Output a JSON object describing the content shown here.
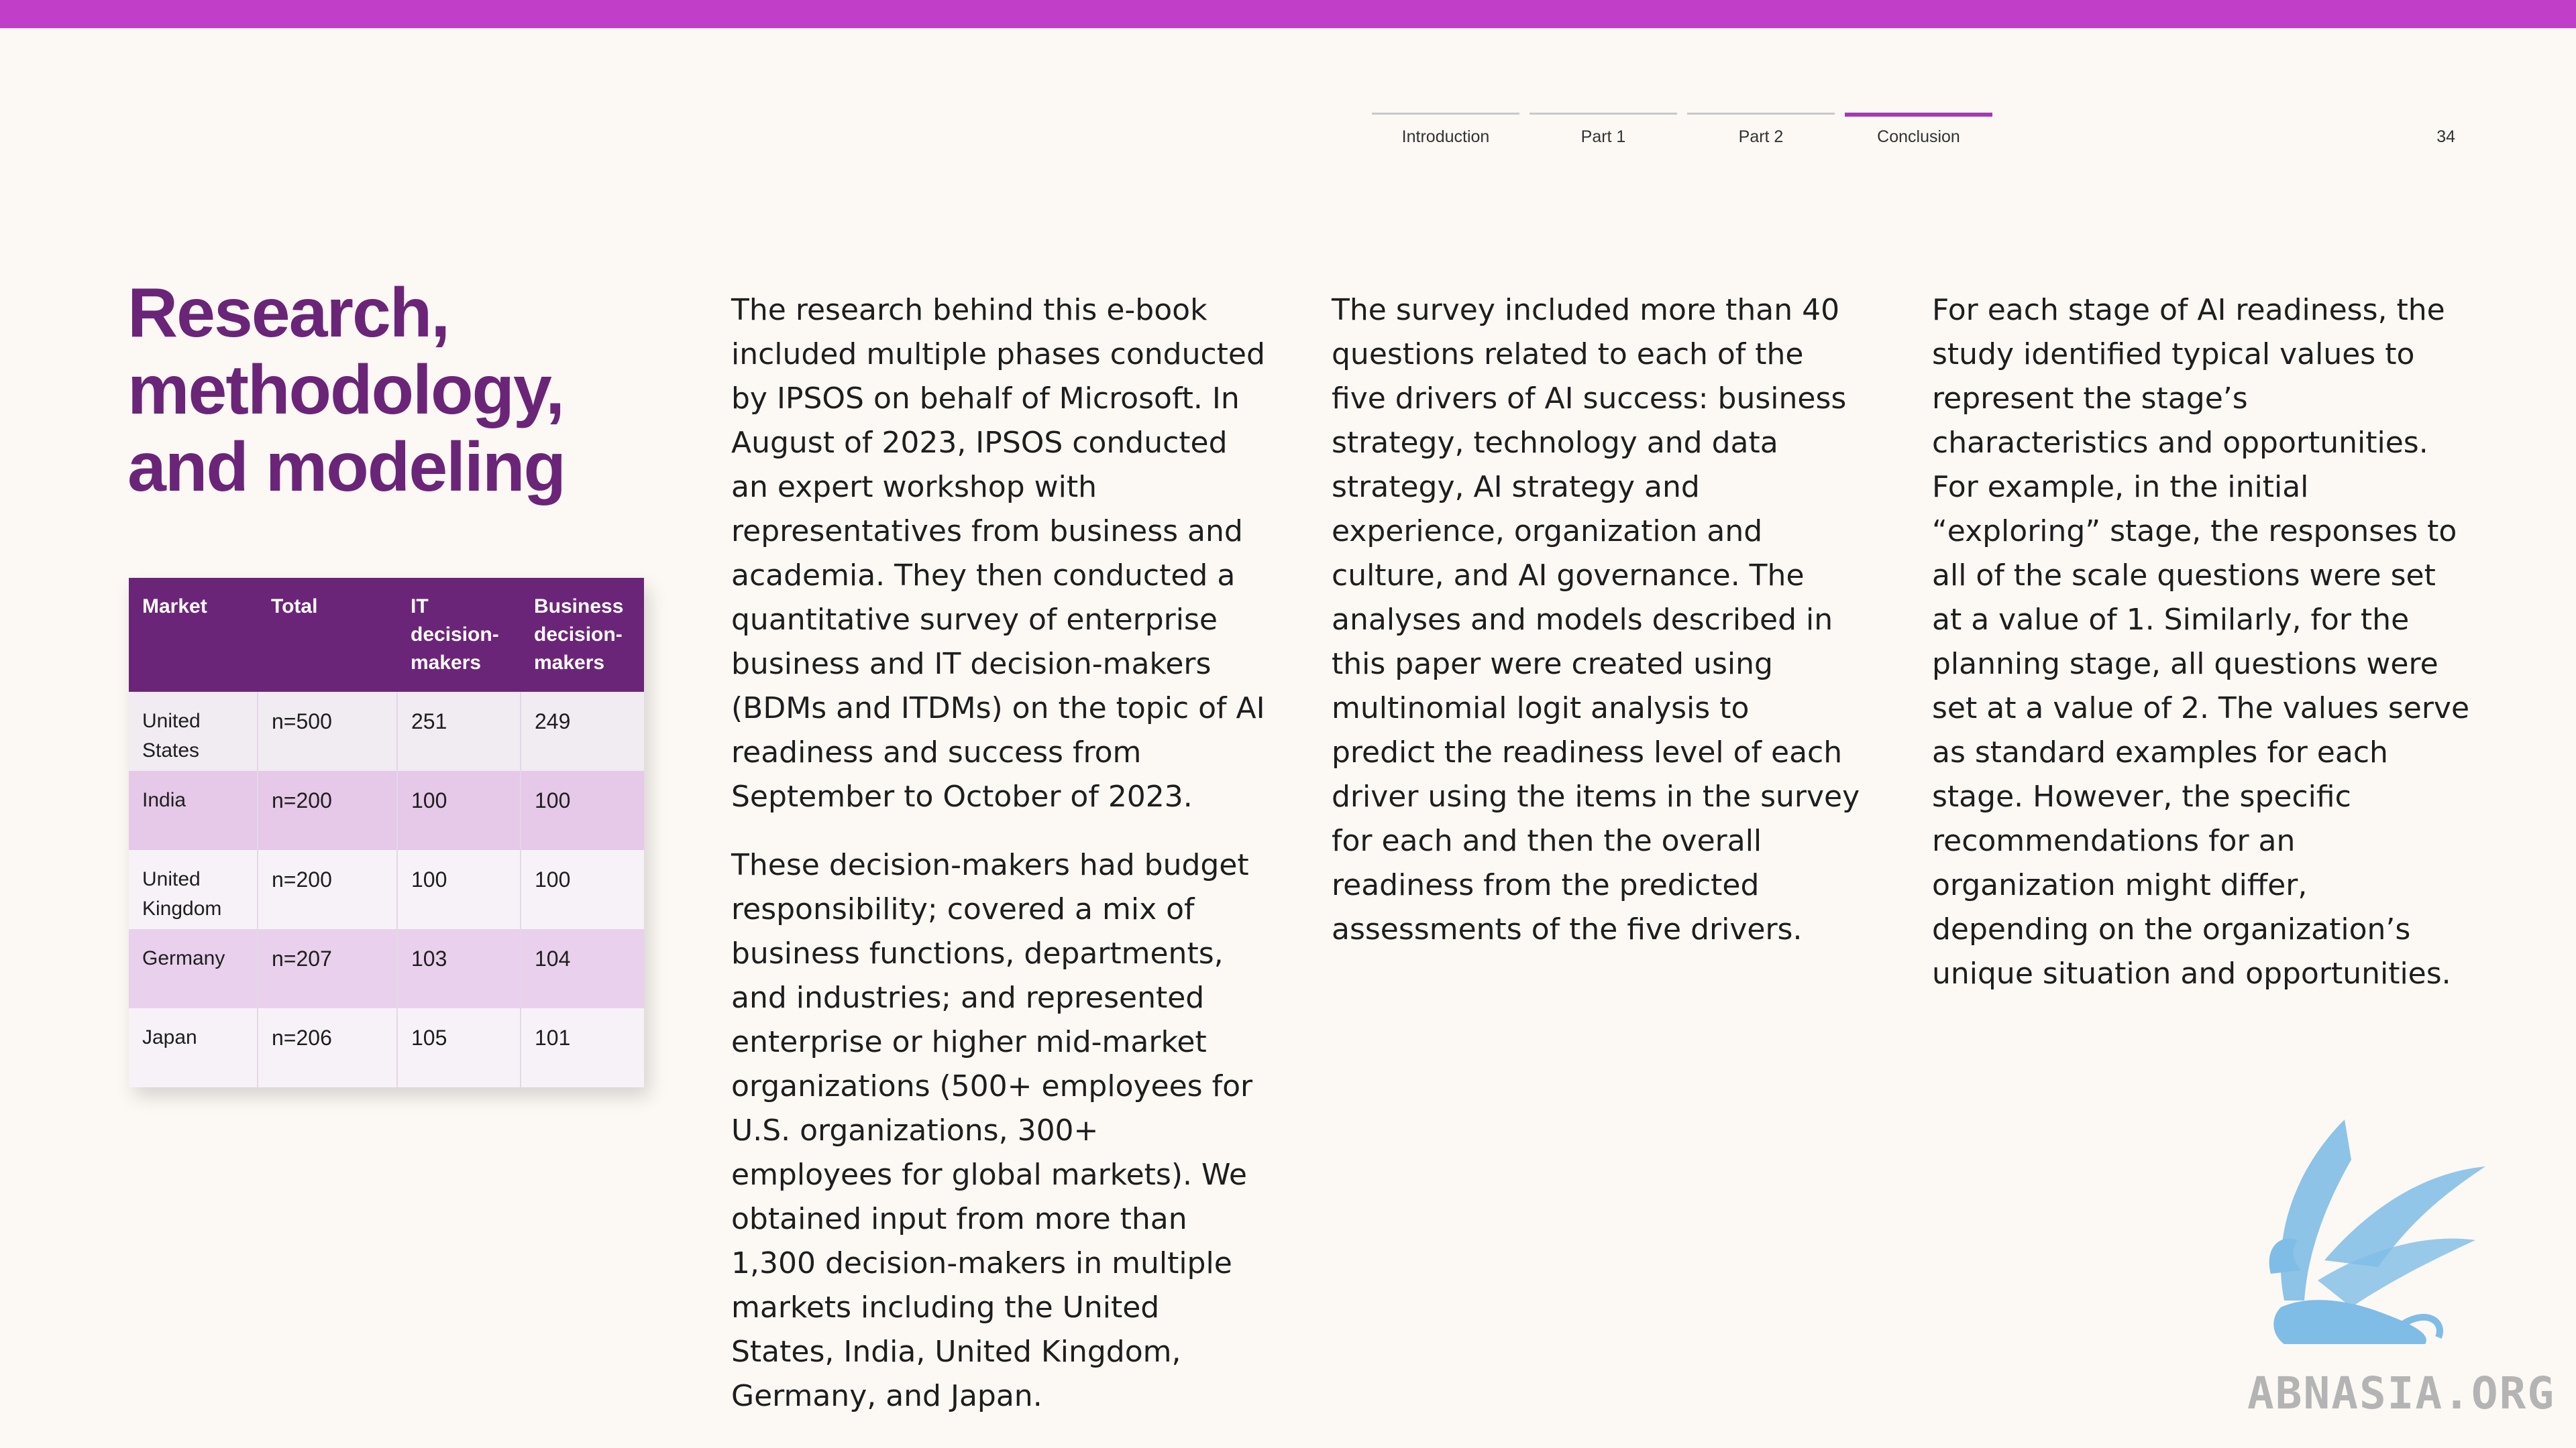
{
  "nav": {
    "items": [
      {
        "label": "Introduction",
        "active": false
      },
      {
        "label": "Part 1",
        "active": false
      },
      {
        "label": "Part 2",
        "active": false
      },
      {
        "label": "Conclusion",
        "active": true
      }
    ],
    "page_number": "34"
  },
  "title": {
    "line1": "Research,",
    "line2": "methodology,",
    "line3": "and modeling"
  },
  "table": {
    "headers": {
      "market": "Market",
      "total": "Total",
      "it": "IT decision-makers",
      "business": "Business decision-makers"
    },
    "rows": [
      {
        "market": "United States",
        "total": "n=500",
        "it": "251",
        "business": "249"
      },
      {
        "market": "India",
        "total": "n=200",
        "it": "100",
        "business": "100"
      },
      {
        "market": "United Kingdom",
        "total": "n=200",
        "it": "100",
        "business": "100"
      },
      {
        "market": "Germany",
        "total": "n=207",
        "it": "103",
        "business": "104"
      },
      {
        "market": "Japan",
        "total": "n=206",
        "it": "105",
        "business": "101"
      }
    ]
  },
  "body": {
    "p1": "The research behind this e-book included multiple phases conducted by IPSOS on behalf of Microsoft. In August of 2023, IPSOS conducted an expert workshop with representatives from business and academia. They then conducted a quantitative survey of enterprise business and IT decision-makers (BDMs and ITDMs) on the topic of AI readiness and success from September to October of 2023.",
    "p2": "These decision-makers had budget responsibility; covered a mix of business functions, departments, and industries; and represented enterprise or higher mid-market organizations (500+ employees for U.S. organizations, 300+ employees for global markets). We obtained input from more than 1,300 decision-makers in multiple markets including the United States, India, United Kingdom, Germany, and Japan.",
    "p3": "The survey included more than 40 questions related to each of the five drivers of AI success: business strategy, technology and data strategy, AI strategy and experience, organization and culture, and AI governance. The analyses and models described in this paper were created using multinomial logit analysis to predict the readiness level of each driver using the items in the survey for each and then the overall readiness from the predicted assessments of the five drivers.",
    "p4": "For each stage of AI readiness, the study identified typical values to represent the stage’s characteristics and opportunities. For example, in the initial “exploring” stage, the responses to all of the scale questions were set at a value of 1. Similarly, for the planning stage, all questions were set at a value of 2. The values serve as standard examples for each stage. However, the specific recommendations for an organization might differ, depending on the organization’s unique situation and opportunities."
  },
  "watermark": {
    "text": "ABNASIA.ORG",
    "icon": "griffin-icon",
    "color": "#7fbde6"
  },
  "colors": {
    "accent": "#c13ec9",
    "title": "#6b2578",
    "table_header": "#6b2578"
  }
}
